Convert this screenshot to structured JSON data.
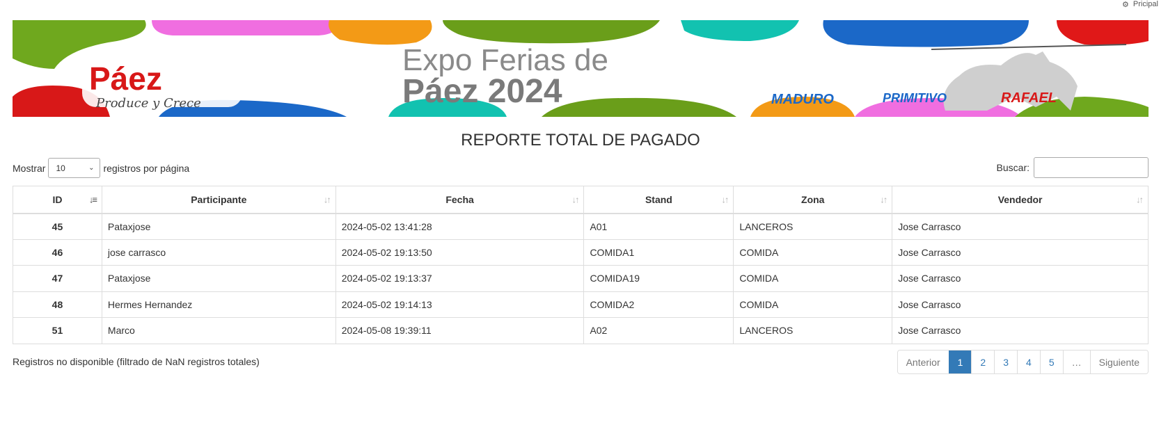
{
  "topnav": {
    "label": "Pricipal",
    "icon": "dashboard-icon"
  },
  "banner": {
    "logo_top": "Páez",
    "logo_tag": "Produce y Crece",
    "headline_line1": "Expo Ferias de",
    "headline_line2": "Páez 2024",
    "badges": [
      "MADURO",
      "PRIMITIVO",
      "RAFAEL"
    ]
  },
  "title": "REPORTE TOTAL DE PAGADO",
  "length": {
    "prefix": "Mostrar",
    "value": "10",
    "suffix": "registros por página"
  },
  "search": {
    "label": "Buscar:",
    "value": "",
    "placeholder": ""
  },
  "table": {
    "headers": [
      "ID",
      "Participante",
      "Fecha",
      "Stand",
      "Zona",
      "Vendedor"
    ],
    "rows": [
      [
        "45",
        "Pataxjose",
        "2024-05-02 13:41:28",
        "A01",
        "LANCEROS",
        "Jose Carrasco"
      ],
      [
        "46",
        "jose carrasco",
        "2024-05-02 19:13:50",
        "COMIDA1",
        "COMIDA",
        "Jose Carrasco"
      ],
      [
        "47",
        "Pataxjose",
        "2024-05-02 19:13:37",
        "COMIDA19",
        "COMIDA",
        "Jose Carrasco"
      ],
      [
        "48",
        "Hermes Hernandez",
        "2024-05-02 19:14:13",
        "COMIDA2",
        "COMIDA",
        "Jose Carrasco"
      ],
      [
        "51",
        "Marco",
        "2024-05-08 19:39:11",
        "A02",
        "LANCEROS",
        "Jose Carrasco"
      ]
    ]
  },
  "info": "Registros no disponible (filtrado de NaN registros totales)",
  "pager": {
    "previous": "Anterior",
    "pages": [
      "1",
      "2",
      "3",
      "4",
      "5"
    ],
    "ellipsis": "…",
    "next": "Siguiente",
    "active_page": "1"
  },
  "colors": {
    "accent": "#337ab7",
    "border": "#dddddd"
  }
}
